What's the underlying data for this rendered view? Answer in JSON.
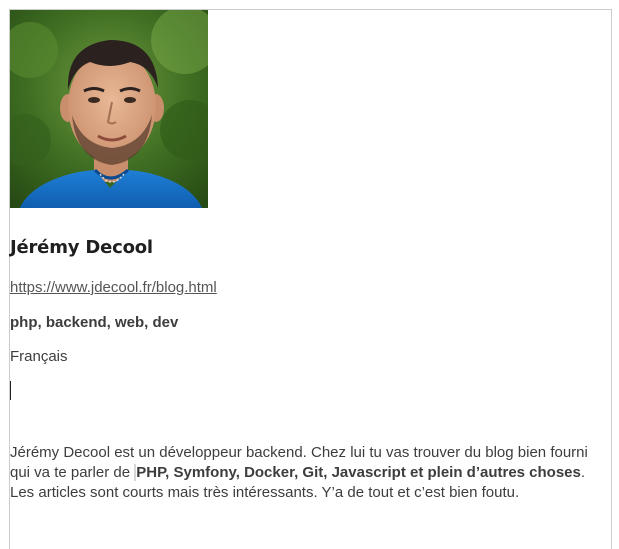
{
  "profile": {
    "photo_icon": "portrait-photo",
    "name": "Jérémy Decool",
    "url": "https://www.jdecool.fr/blog.html",
    "tags": "php, backend, web, dev",
    "language": "Français",
    "description": {
      "part1": "Jérémy Decool est un développeur backend. Chez lui tu vas trouver du blog bien fourni qui va te parler de",
      "bold": "PHP, Symfony, Docker, Git, Javascript et plein d’autres choses",
      "part2": ". Les articles sont courts mais très intéressants. Y’a de tout et c’est bien foutu."
    }
  }
}
